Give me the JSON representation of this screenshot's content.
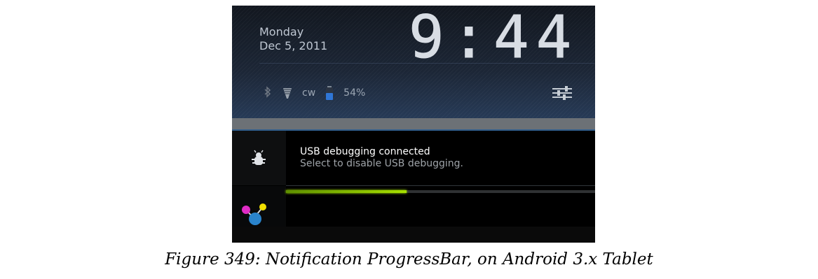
{
  "status_bar": {
    "day": "Monday",
    "date": "Dec 5, 2011",
    "time": "9:44",
    "wifi_label": "cw",
    "battery_percent": "54%",
    "battery_level": 0.54,
    "icons": {
      "bluetooth": "bluetooth-icon",
      "wifi": "wifi-icon",
      "battery": "battery-icon",
      "settings": "settings-icon"
    }
  },
  "notifications": [
    {
      "icon": "usb-debug-icon",
      "title": "USB debugging connected",
      "subtitle": "Select to disable USB debugging."
    },
    {
      "icon": "download-progress-icon",
      "progress": 0.39
    }
  ],
  "caption": "Figure 349: Notification ProgressBar, on Android 3.x Tablet",
  "colors": {
    "progress": "#a6df00",
    "background": "#000000",
    "header": "#1c2636",
    "accent_line": "#315e8c"
  }
}
